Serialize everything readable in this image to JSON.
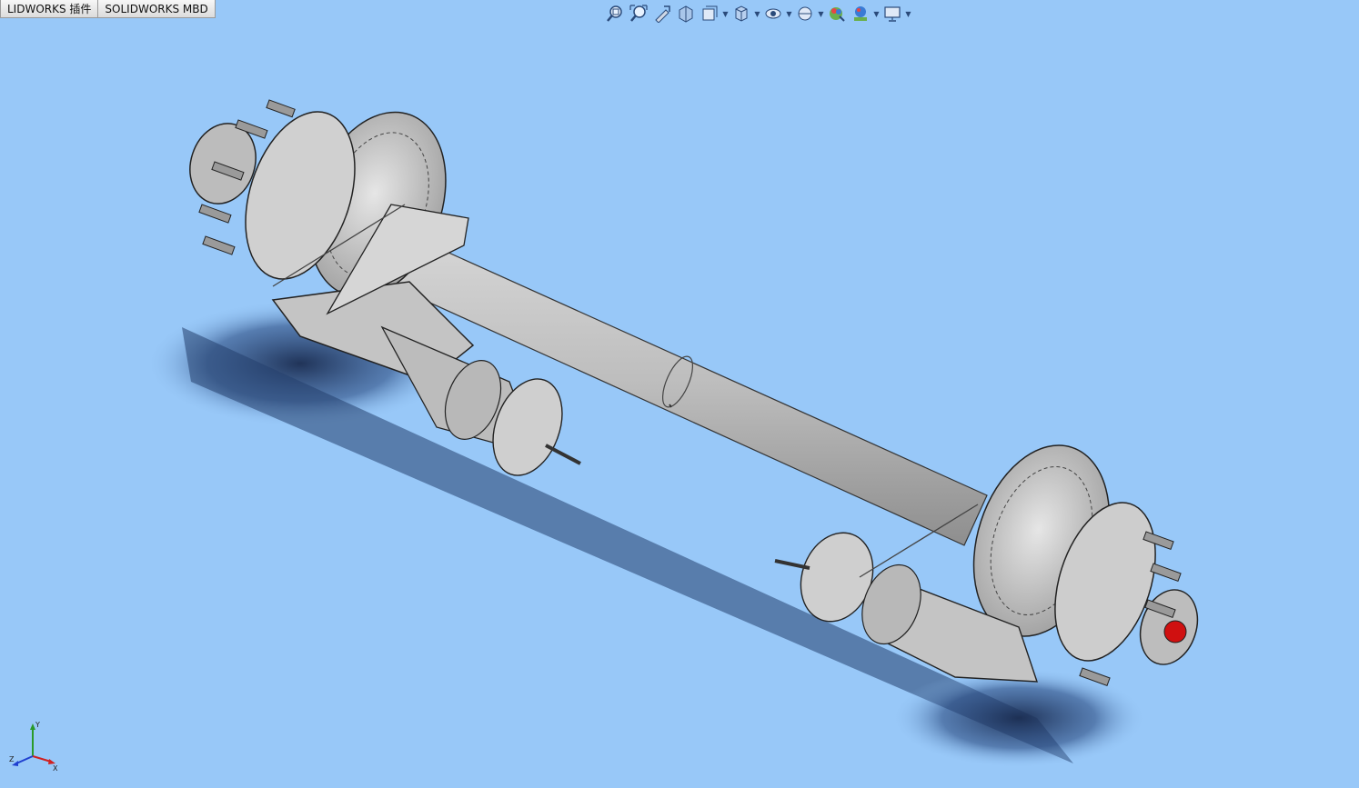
{
  "tabs": [
    {
      "label": "LIDWORKS 插件"
    },
    {
      "label": "SOLIDWORKS MBD"
    }
  ],
  "toolbar": {
    "buttons": [
      {
        "icon": "zoom-to-fit-icon"
      },
      {
        "icon": "zoom-to-area-icon"
      },
      {
        "icon": "previous-view-icon"
      },
      {
        "icon": "section-view-icon"
      },
      {
        "icon": "dynamic-annotation-view-icon",
        "dropdown": true
      },
      {
        "icon": "view-orientation-icon",
        "dropdown": true
      },
      {
        "icon": "display-style-icon",
        "dropdown": true
      },
      {
        "icon": "hide-show-items-icon",
        "dropdown": true
      },
      {
        "icon": "edit-appearance-icon"
      },
      {
        "icon": "apply-scene-icon",
        "dropdown": true
      },
      {
        "icon": "view-settings-icon",
        "dropdown": true
      }
    ]
  },
  "triad": {
    "x": "X",
    "y": "Y",
    "z": "Z"
  },
  "colors": {
    "background": "#98c8f8",
    "part": "#c8c8c8",
    "accent_red": "#d01010"
  }
}
